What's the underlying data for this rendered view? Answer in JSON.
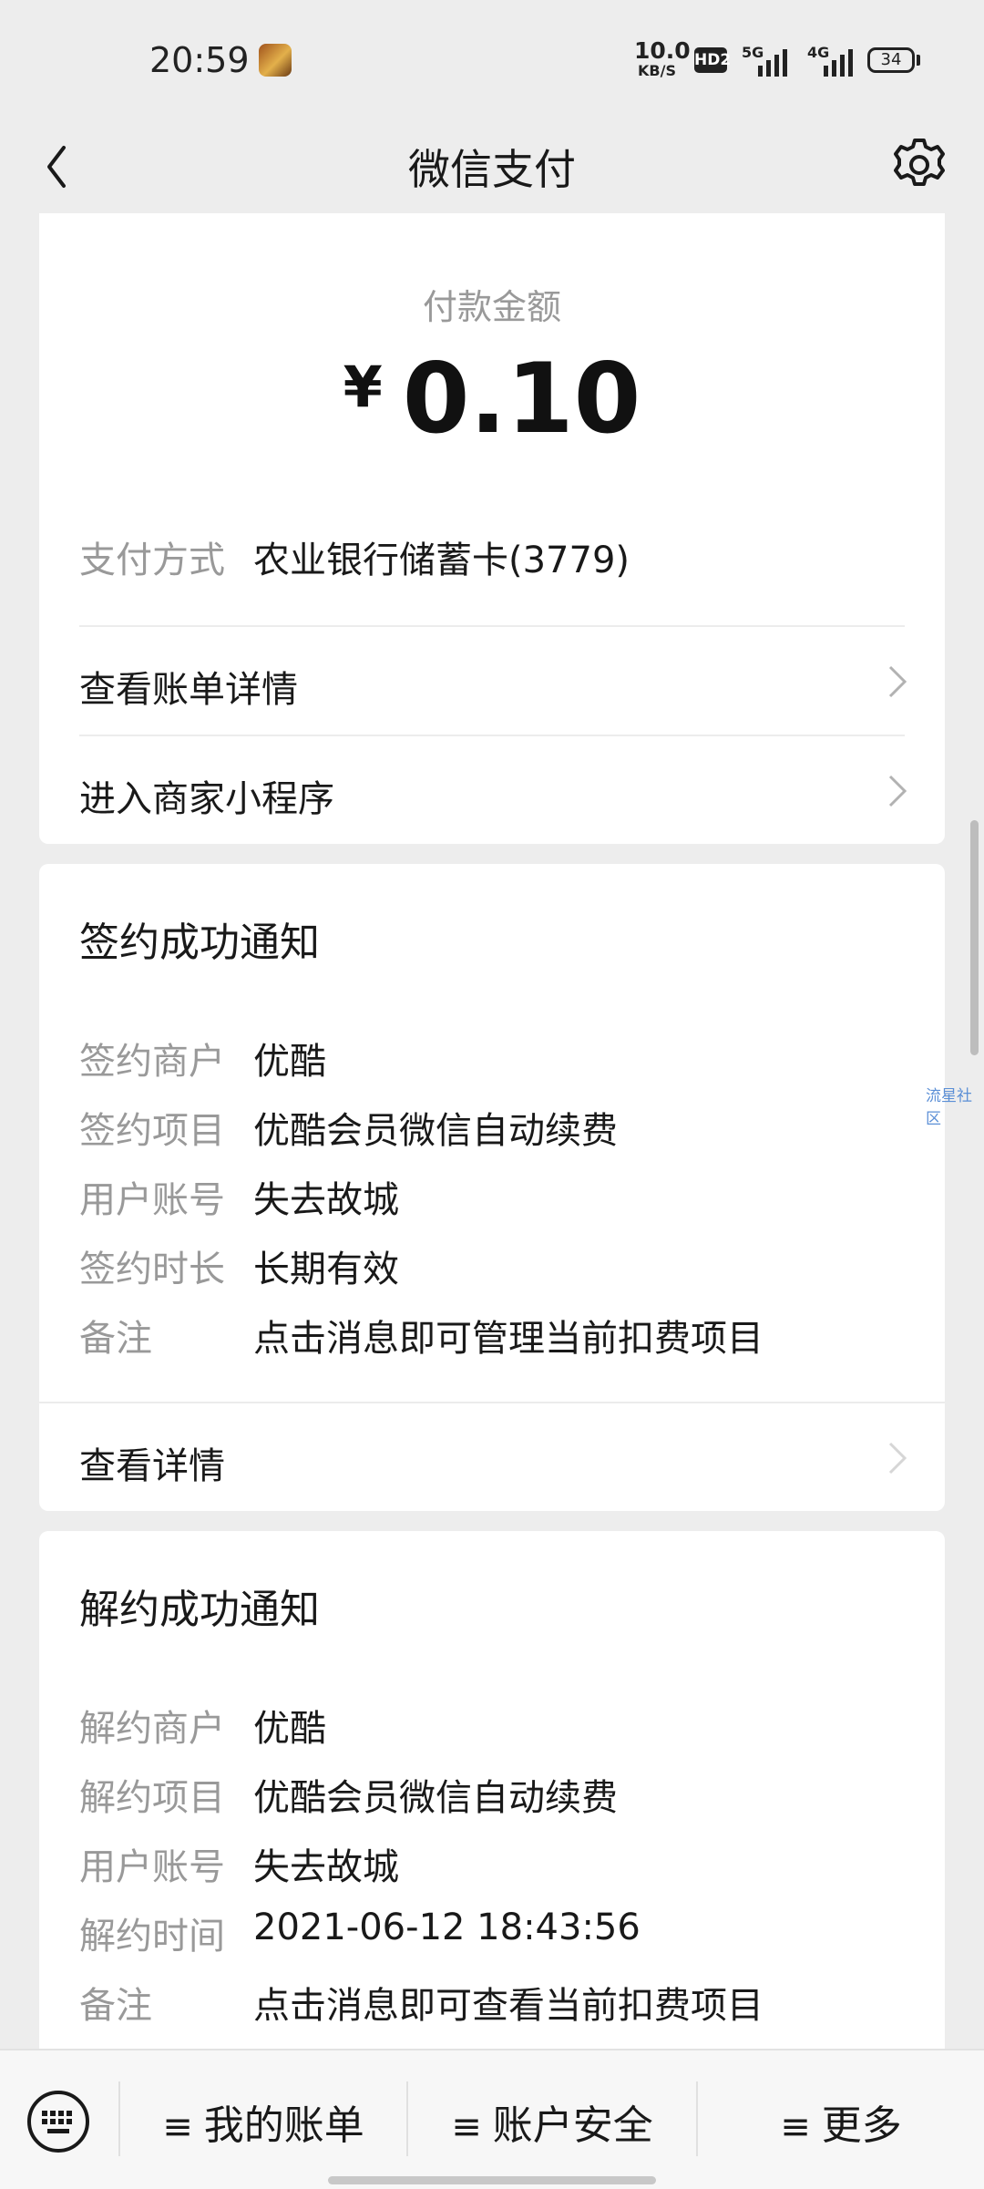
{
  "status_bar": {
    "time": "20:59",
    "network_speed_value": "10.0",
    "network_speed_unit": "KB/S",
    "hd_label": "HD2",
    "sim1_generation": "5G",
    "sim2_generation": "4G",
    "battery": "34",
    "app_icon": "game-app-icon"
  },
  "nav": {
    "title": "微信支付",
    "back_icon": "chevron-left-icon",
    "settings_icon": "gear-icon"
  },
  "payment_card": {
    "amount_label": "付款金额",
    "currency": "¥",
    "amount": "0.10",
    "method_label": "支付方式",
    "method_value": "农业银行储蓄卡(3779)",
    "links": [
      {
        "label": "查看账单详情"
      },
      {
        "label": "进入商家小程序"
      }
    ]
  },
  "sign_card": {
    "title": "签约成功通知",
    "rows": [
      {
        "label": "签约商户",
        "value": "优酷"
      },
      {
        "label": "签约项目",
        "value": "优酷会员微信自动续费"
      },
      {
        "label": "用户账号",
        "value": "失去故城"
      },
      {
        "label": "签约时长",
        "value": "长期有效"
      },
      {
        "label": "备注",
        "value": "点击消息即可管理当前扣费项目"
      }
    ],
    "link_label": "查看详情"
  },
  "cancel_card": {
    "title": "解约成功通知",
    "rows": [
      {
        "label": "解约商户",
        "value": "优酷"
      },
      {
        "label": "解约项目",
        "value": "优酷会员微信自动续费"
      },
      {
        "label": "用户账号",
        "value": "失去故城"
      },
      {
        "label": "解约时间",
        "value": "2021-06-12 18:43:56"
      },
      {
        "label": "备注",
        "value": "点击消息即可查看当前扣费项目"
      }
    ]
  },
  "watermark": "流星社区",
  "bottom_bar": {
    "keyboard_icon": "keyboard-icon",
    "items": [
      {
        "label": "我的账单",
        "icon": "menu-lines-icon"
      },
      {
        "label": "账户安全",
        "icon": "menu-lines-icon"
      },
      {
        "label": "更多",
        "icon": "menu-lines-icon"
      }
    ]
  },
  "colors": {
    "background": "#ededed",
    "card": "#ffffff",
    "label_gray": "#999999",
    "text": "#191919"
  }
}
